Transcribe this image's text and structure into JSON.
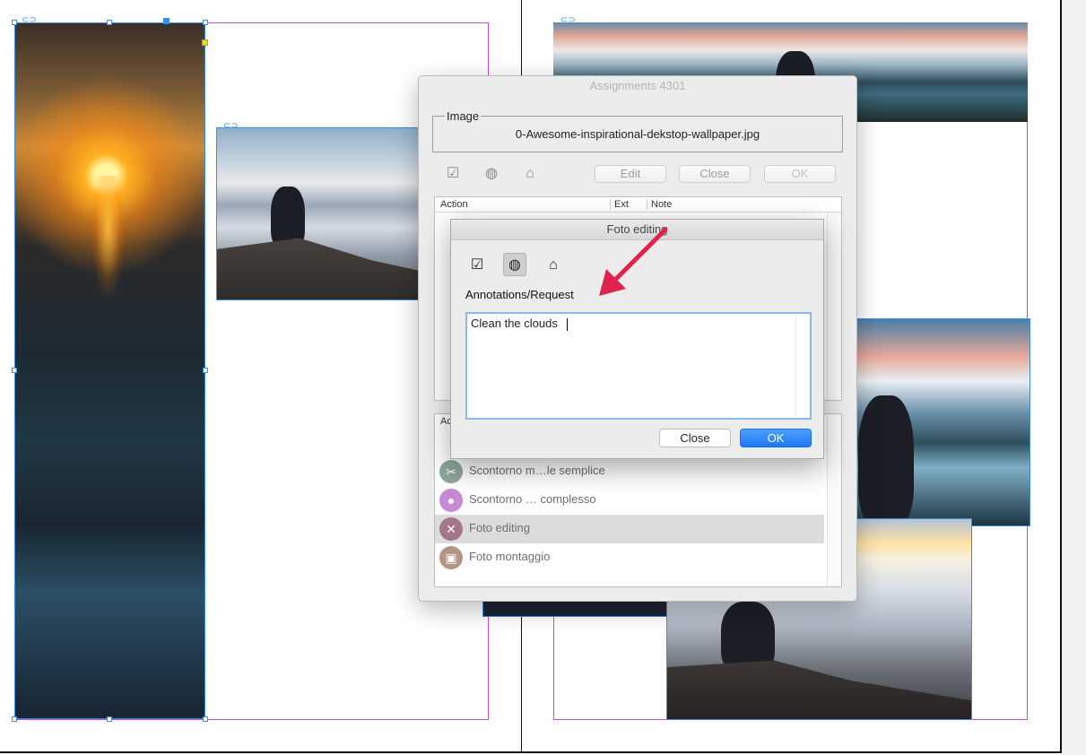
{
  "main_dialog": {
    "title": "Assignments 4301",
    "image_group_label": "Image",
    "image_filename": "0-Awesome-inspirational-dekstop-wallpaper.jpg",
    "toolbar_icons": [
      "checklist-icon",
      "globe-icon",
      "home-icon"
    ],
    "buttons": {
      "edit": "Edit",
      "close": "Close",
      "ok": "OK"
    },
    "table_headers": {
      "action": "Action",
      "ext": "Ext",
      "note": "Note"
    },
    "list_header": "Ac",
    "list_items": [
      {
        "label": "Scontorno m…le semplice",
        "icon": "scissors-icon",
        "color": "#8fa79a",
        "selected": false
      },
      {
        "label": "Scontorno … complesso",
        "icon": "people-icon",
        "color": "#c78ad6",
        "selected": false
      },
      {
        "label": "Foto editing",
        "icon": "brush-icon",
        "color": "#a4768a",
        "selected": true
      },
      {
        "label": "Foto montaggio",
        "icon": "photo-stack-icon",
        "color": "#b39486",
        "selected": false
      }
    ]
  },
  "sub_dialog": {
    "title": "Foto editing",
    "icons": [
      "checklist-icon",
      "globe-icon",
      "home-icon"
    ],
    "active_icon": "globe-icon",
    "field_label": "Annotations/Request",
    "field_value": "Clean the clouds",
    "buttons": {
      "close": "Close",
      "ok": "OK"
    }
  },
  "colors": {
    "frame": "#c64bd6",
    "selection": "#3a8ee6",
    "ok_button": "#1d78f2",
    "arrow": "#e0234e"
  }
}
